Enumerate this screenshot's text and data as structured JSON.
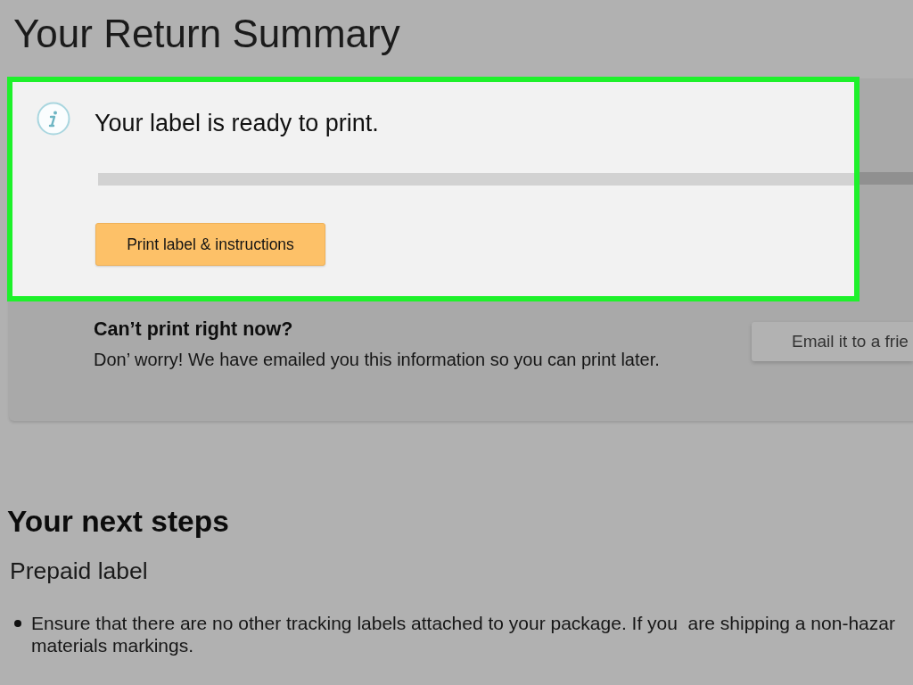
{
  "page": {
    "title": "Your Return Summary"
  },
  "label_panel": {
    "highlighted": true,
    "message": "Your label is ready to print.",
    "print_button": "Print label & instructions"
  },
  "cant_print": {
    "heading": "Can’t print right now?",
    "text": "Don’ worry! We have emailed you this information so you can print later.",
    "email_button": "Email it to a frie"
  },
  "next_steps": {
    "heading": "Your next steps",
    "subheading": "Prepaid label",
    "items": [
      {
        "lines": [
          "Ensure that there are no other tracking labels attached to your package. If you  are shipping a non-hazar",
          "materials markings."
        ]
      }
    ]
  }
}
